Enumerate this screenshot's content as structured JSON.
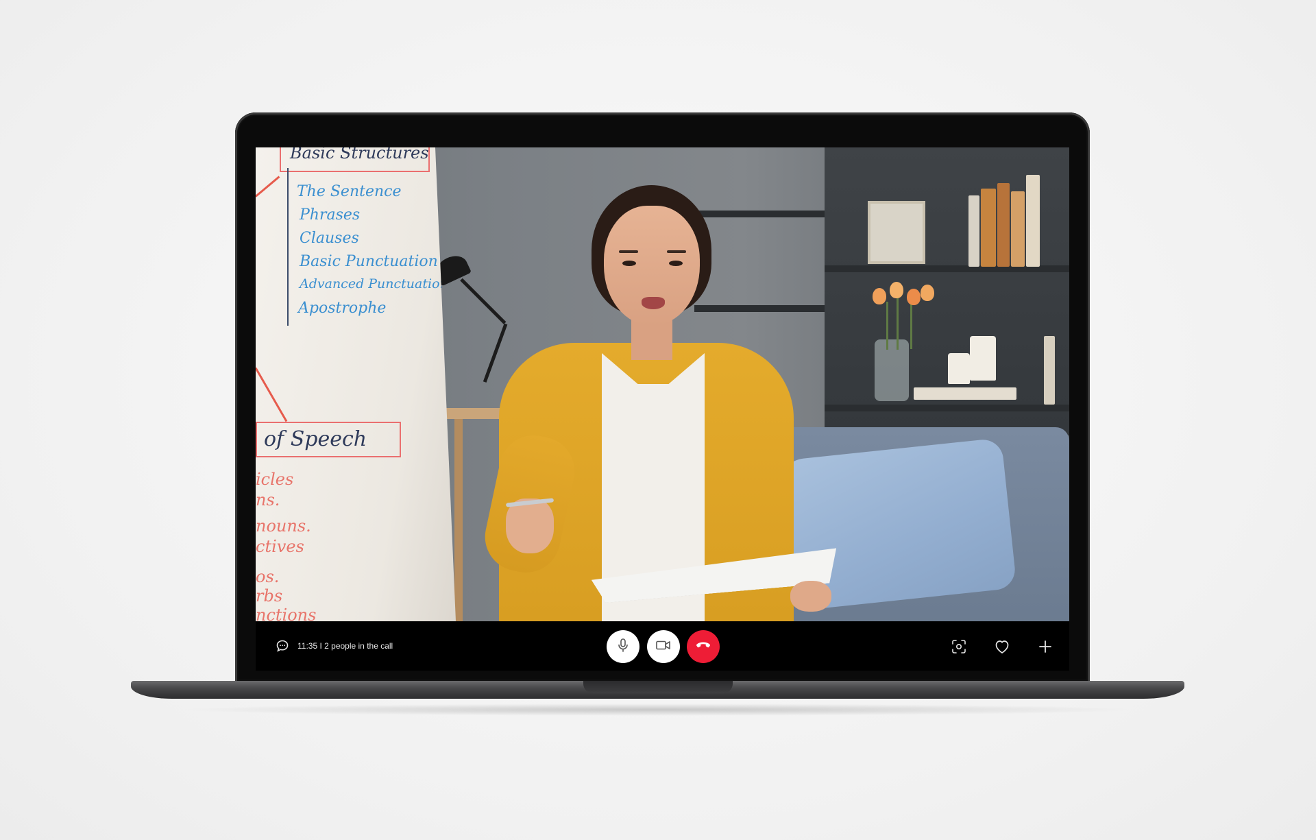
{
  "call": {
    "info_text": "11:35 I 2 people in the call"
  },
  "controls": {
    "chat_icon": "chat-bubble-icon",
    "mic_icon": "microphone-icon",
    "camera_icon": "video-camera-icon",
    "end_icon": "hang-up-icon",
    "screenshot_icon": "screenshot-icon",
    "like_icon": "heart-icon",
    "add_icon": "plus-icon",
    "end_call_color": "#ee1d36"
  },
  "flipchart": {
    "heading": "Basic Structures",
    "items": [
      "The Sentence",
      "Phrases",
      "Clauses",
      "Basic Punctuation",
      "Advanced Punctuation",
      "Apostrophe"
    ],
    "section_title": "of Speech",
    "section_items": [
      "icles",
      "ns.",
      "nouns.",
      "ctives",
      "os.",
      "rbs",
      "nctions"
    ]
  }
}
